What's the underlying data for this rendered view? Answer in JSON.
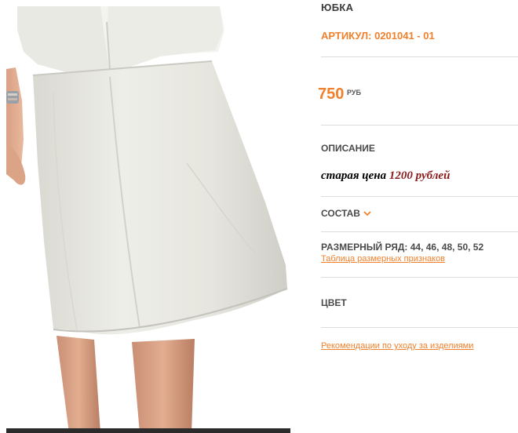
{
  "product": {
    "title": "ЮБКА",
    "article": "АРТИКУЛ: 0201041 - 01",
    "price": "750",
    "currency": "РУБ"
  },
  "description": {
    "heading": "ОПИСАНИЕ",
    "old_price_prefix": "старая цена",
    "old_price_amount": "1200 рублей"
  },
  "composition": {
    "heading": "СОСТАВ",
    "icon": "chevron-down-icon"
  },
  "sizes": {
    "label": "РАЗМЕРНЫЙ РЯД:",
    "values": "44, 46, 48, 50, 52",
    "chart_link": "Таблица размерных признаков"
  },
  "color": {
    "heading": "ЦВЕТ"
  },
  "care": {
    "link": "Рекомендации по уходу за изделиями"
  },
  "colors": {
    "accent": "#f0802c",
    "text": "#4a4a4a",
    "divider": "#dcdcdc",
    "old_price_amount": "#8b1a1a"
  }
}
